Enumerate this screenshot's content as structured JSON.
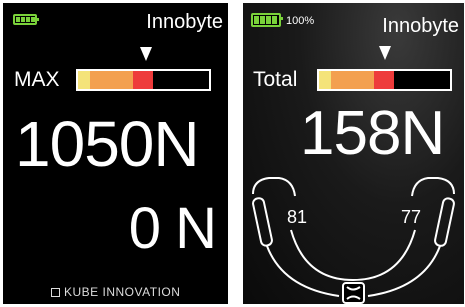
{
  "left_device": {
    "brand": "Innobyte",
    "gauge_label": "MAX",
    "primary_value": "1050N",
    "secondary_value": "0 N",
    "footer": "KUBE INNOVATION",
    "gauge_level": 0.56
  },
  "right_device": {
    "battery_percent": "100%",
    "brand": "Innobyte",
    "gauge_label": "Total",
    "primary_value": "158N",
    "left_value": "81",
    "right_value": "77",
    "gauge_level": 0.56
  },
  "colors": {
    "battery": "#7ad23a",
    "gauge_yellow": "#f4e37a",
    "gauge_orange": "#f3a050",
    "gauge_red": "#ee3b3b"
  }
}
